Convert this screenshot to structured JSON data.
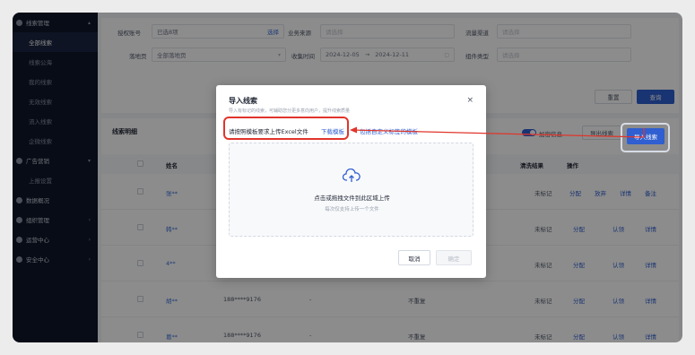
{
  "sidebar": {
    "section_title": "线索管理",
    "items": [
      {
        "label": "全部线索",
        "active": true
      },
      {
        "label": "线索公海"
      },
      {
        "label": "我的线索"
      },
      {
        "label": "无效线索"
      },
      {
        "label": "流入线索"
      },
      {
        "label": "企微线索"
      }
    ],
    "groups": [
      {
        "label": "广告营销",
        "sub": "上报设置"
      },
      {
        "label": "数据概况"
      },
      {
        "label": "组织管理"
      },
      {
        "label": "运营中心"
      },
      {
        "label": "安全中心"
      }
    ]
  },
  "filters": {
    "account_label": "授权账号",
    "account_value": "已选8项",
    "account_action": "选择",
    "source_label": "业务来源",
    "source_placeholder": "请选择",
    "channel_label": "流量渠道",
    "channel_placeholder": "请选择",
    "landing_label": "落地页",
    "landing_value": "全部落地页",
    "time_label": "收集时间",
    "date_start": "2024-12-05",
    "date_sep": "→",
    "date_end": "2024-12-11",
    "component_label": "组件类型",
    "component_placeholder": "请选择",
    "reset_label": "重置",
    "query_label": "查询"
  },
  "table": {
    "title": "线索明细",
    "toolbar": {
      "encrypt_label": "加密信息",
      "export_label": "导出线索",
      "import_label": "导入线索"
    },
    "columns": [
      "姓名",
      "电话",
      "清洗结果",
      "操作"
    ],
    "rows": [
      {
        "name": "张**",
        "phone": "17",
        "cleaned": "",
        "result": "未标记",
        "ops": [
          "分配",
          "放弃",
          "详情",
          "备注"
        ]
      },
      {
        "name": "韩**",
        "phone": "18",
        "cleaned": "",
        "result": "未标记",
        "ops": [
          "分配",
          "认领",
          "详情"
        ]
      },
      {
        "name": "4**",
        "phone": "18",
        "cleaned": "",
        "result": "未标记",
        "ops": [
          "分配",
          "认领",
          "详情"
        ]
      },
      {
        "name": "胡**",
        "phone": "188****9176",
        "dash": "-",
        "cleaned": "不重复",
        "result": "未标记",
        "ops": [
          "分配",
          "认领",
          "详情"
        ]
      },
      {
        "name": "葛**",
        "phone": "188****9176",
        "dash": "-",
        "cleaned": "不重复",
        "result": "未标记",
        "ops": [
          "分配",
          "认领",
          "详情"
        ]
      }
    ]
  },
  "modal": {
    "title": "导入线索",
    "subtitle": "导入有标记的线索，可辅助您分更多意向用户，提升线索质量",
    "close": "×",
    "instruction": "请按照模板要求上传Excel文件",
    "download_link": "下载模板",
    "custom_link": "包括自定义标签的模板",
    "drop_main": "点击或拖拽文件到此区域上传",
    "drop_sub": "每次仅支持上传一个文件",
    "cancel_label": "取消",
    "ok_label": "确定"
  },
  "colors": {
    "highlight": "#e0352b",
    "primary": "#2f5fd0"
  }
}
